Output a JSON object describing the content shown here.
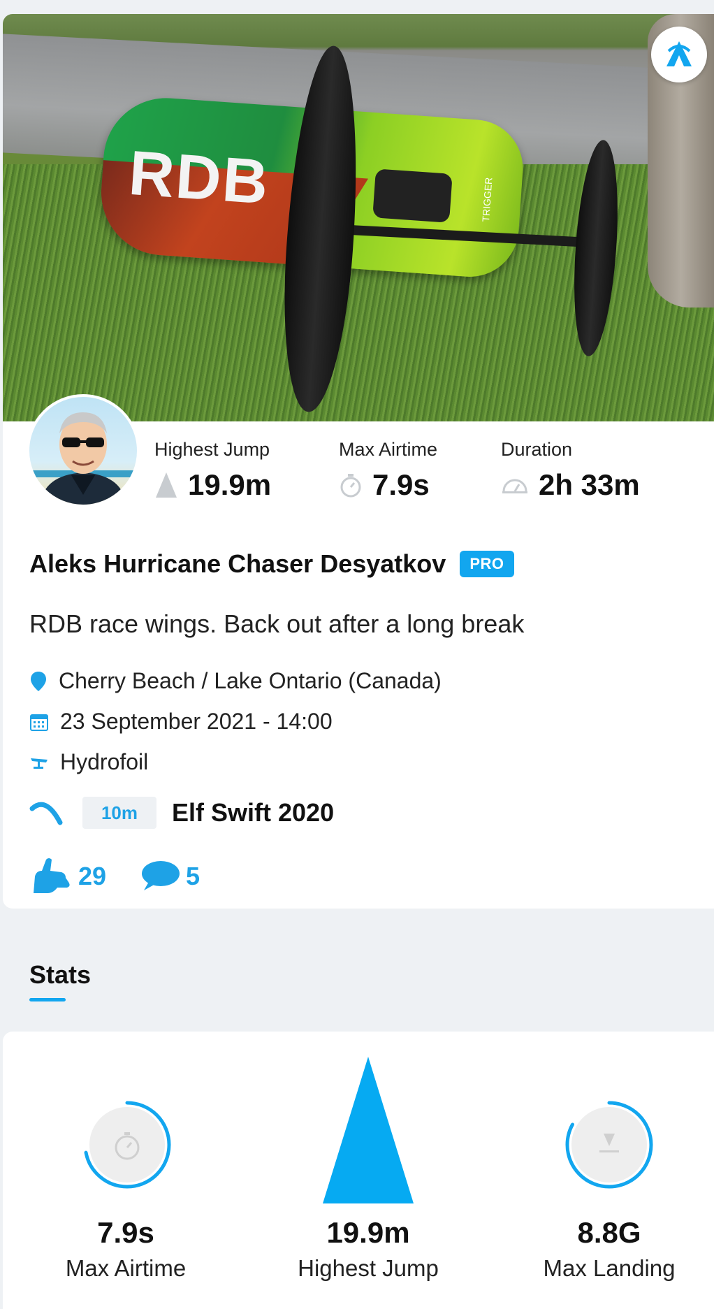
{
  "activity": {
    "photo_brand_text": "RDB",
    "photo_board_text": "TRIGGER",
    "rider_name": "Aleks Hurricane Chaser Desyatkov",
    "badge": "PRO",
    "description": "RDB race wings. Back out after a long break",
    "location": "Cherry Beach / Lake Ontario (Canada)",
    "datetime": "23 September 2021 - 14:00",
    "sport": "Hydrofoil",
    "kite_size": "10m",
    "kite_name": "Elf Swift 2020",
    "likes": "29",
    "comments": "5"
  },
  "summary": [
    {
      "label": "Highest Jump",
      "value": "19.9m",
      "icon": "jump-icon"
    },
    {
      "label": "Max Airtime",
      "value": "7.9s",
      "icon": "stopwatch-icon"
    },
    {
      "label": "Duration",
      "value": "2h 33m",
      "icon": "speedometer-icon"
    }
  ],
  "tabs": {
    "stats_label": "Stats"
  },
  "stats": [
    {
      "label": "Max Airtime",
      "value": "7.9s",
      "icon": "stopwatch-icon",
      "ring_fraction": 0.72
    },
    {
      "label": "Highest Jump",
      "value": "19.9m",
      "icon": "jump-icon"
    },
    {
      "label": "Max Landing",
      "value": "8.8G",
      "icon": "landing-icon",
      "ring_fraction": 0.83
    }
  ],
  "colors": {
    "accent": "#12a6ef",
    "accent_text": "#1ea2e6",
    "background": "#eef1f4"
  }
}
